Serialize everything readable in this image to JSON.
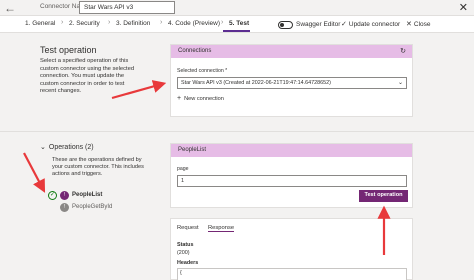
{
  "header": {
    "connector_name_label": "Connector Name",
    "connector_name_value": "Star Wars API v3",
    "close_glyph": "✕"
  },
  "steps": [
    {
      "label": "1. General",
      "active": false
    },
    {
      "label": "2. Security",
      "active": false
    },
    {
      "label": "3. Definition",
      "active": false
    },
    {
      "label": "4. Code (Preview)",
      "active": false
    },
    {
      "label": "5. Test",
      "active": true
    }
  ],
  "toolbar": {
    "swagger_label": "Swagger Editor",
    "update_label": "Update connector",
    "close_label": "Close"
  },
  "test_operation": {
    "title": "Test operation",
    "description": "Select a specified operation of this custom connector using the selected connection. You must update the custom connector in order to test recent changes."
  },
  "connections": {
    "header": "Connections",
    "selected_label": "Selected connection *",
    "selected_value": "Star Wars API v3 (Created at 2022-06-21T19:47:14.64728652)",
    "new_connection_label": "New connection"
  },
  "operations": {
    "title": "Operations (2)",
    "description": "These are the operations defined by your custom connector. This includes actions and triggers.",
    "items": [
      {
        "name": "PeopleList",
        "selected": true
      },
      {
        "name": "PeopleGetById",
        "selected": false
      }
    ]
  },
  "people_list": {
    "header": "PeopleList",
    "param_label": "page",
    "param_value": "1",
    "test_button_label": "Test operation"
  },
  "response_panel": {
    "tabs": [
      "Request",
      "Response"
    ],
    "active_tab": "Response",
    "status_label": "Status",
    "status_value": "(200)",
    "headers_label": "Headers",
    "headers_value": "{"
  },
  "colors": {
    "accent": "#742774",
    "header_band": "#e6bce6",
    "arrow": "#e8393b",
    "success": "#107c10"
  }
}
